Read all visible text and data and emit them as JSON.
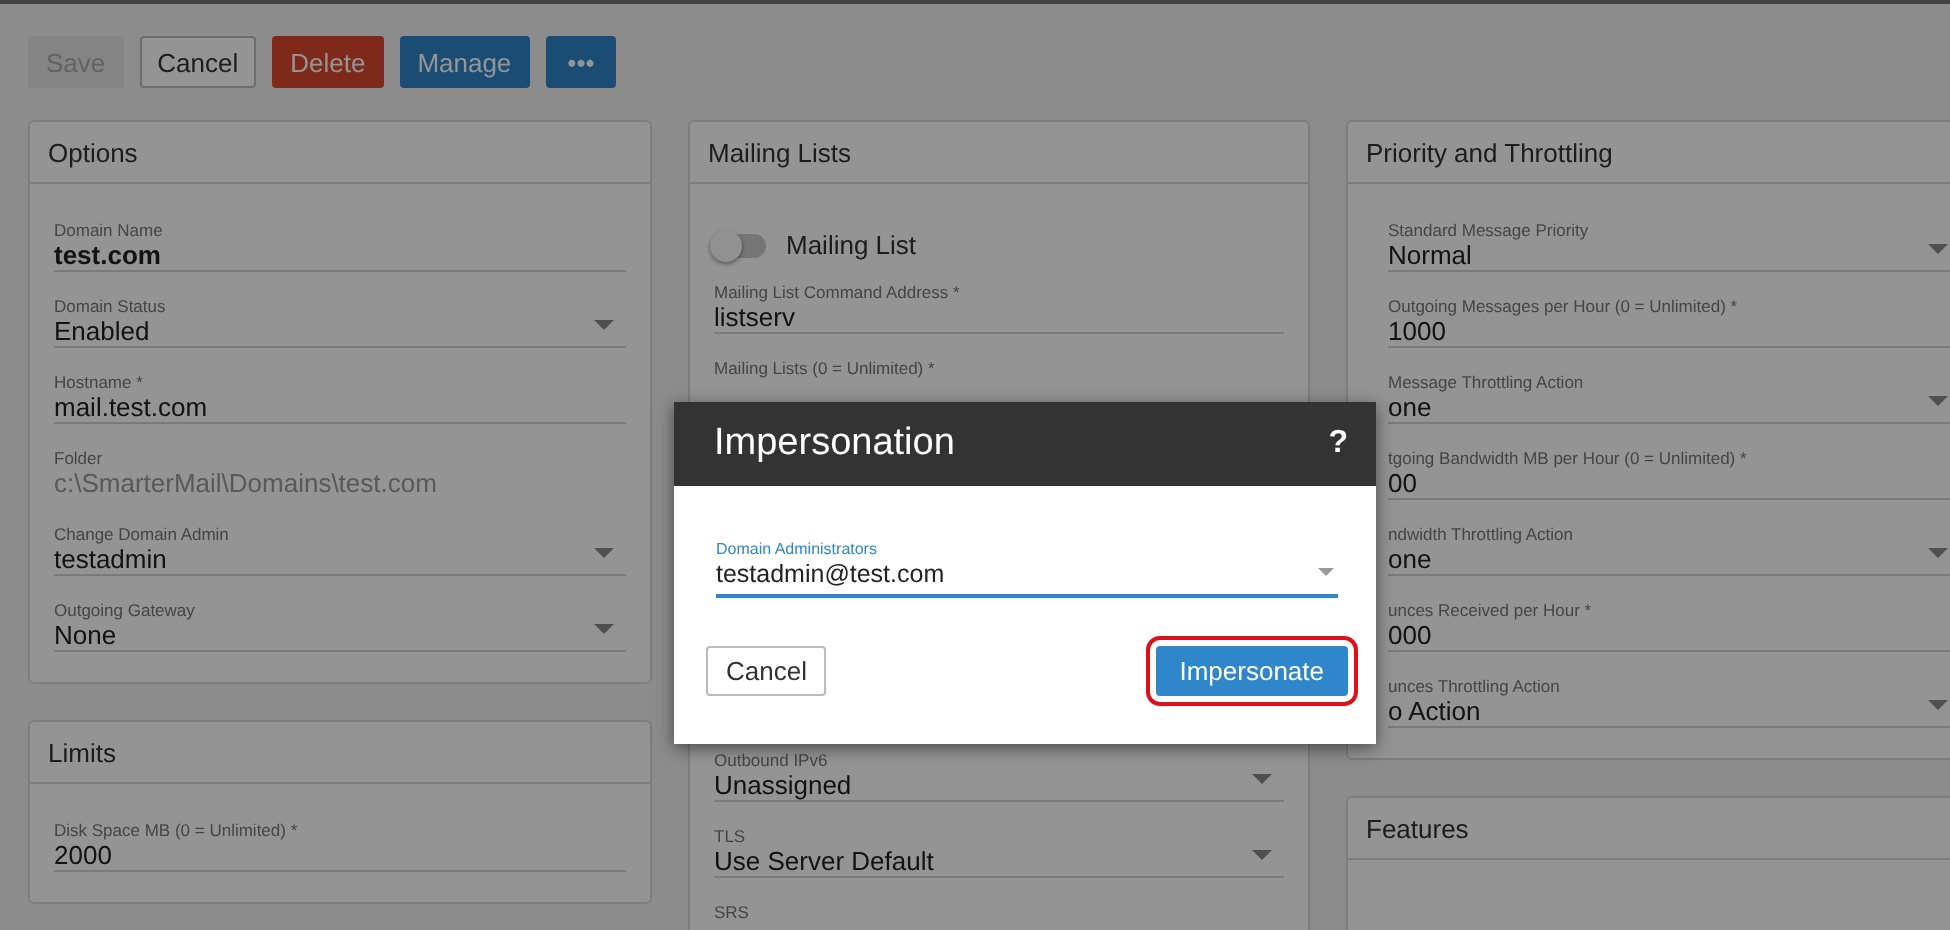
{
  "toolbar": {
    "buttons": [
      {
        "label": "Save",
        "kind": "plain",
        "disabled": true
      },
      {
        "label": "Cancel",
        "kind": "outline",
        "disabled": false
      },
      {
        "label": "Delete",
        "kind": "danger",
        "disabled": false
      },
      {
        "label": "Manage",
        "kind": "primary",
        "disabled": false
      },
      {
        "label": "•••",
        "kind": "primary",
        "disabled": false
      }
    ]
  },
  "columns": [
    {
      "cards": [
        {
          "title": "Options",
          "items": [
            {
              "kind": "text",
              "label": "Domain Name",
              "value": "test.com",
              "disabled": false,
              "bold": true
            },
            {
              "kind": "select",
              "label": "Domain Status",
              "value": "Enabled",
              "disabled": false
            },
            {
              "kind": "input",
              "label": "Hostname *",
              "value": "mail.test.com",
              "disabled": false
            },
            {
              "kind": "input",
              "label": "Folder",
              "value": "c:\\SmarterMail\\Domains\\test.com",
              "disabled": true
            },
            {
              "kind": "select",
              "label": "Change Domain Admin",
              "value": "testadmin",
              "disabled": false
            },
            {
              "kind": "select",
              "label": "Outgoing Gateway",
              "value": "None",
              "disabled": false
            }
          ]
        },
        {
          "title": "Limits",
          "items": [
            {
              "kind": "input",
              "label": "Disk Space MB (0 = Unlimited) *",
              "value": "2000",
              "disabled": false
            }
          ]
        }
      ]
    },
    {
      "cards": [
        {
          "title": "Mailing Lists",
          "items": [
            {
              "kind": "toggle",
              "label": "Mailing List",
              "on": false
            },
            {
              "kind": "input",
              "label": "Mailing List Command Address *",
              "value": "listserv",
              "disabled": false
            },
            {
              "kind": "input",
              "label": "Mailing Lists (0 = Unlimited) *"
            },
            {
              "kind": "select",
              "label": "Outbound IPv6",
              "value": "Unassigned",
              "disabled": false
            },
            {
              "kind": "select",
              "label": "TLS",
              "value": "Use Server Default",
              "disabled": false
            },
            {
              "kind": "input",
              "label": "SRS"
            }
          ]
        }
      ]
    },
    {
      "cards": [
        {
          "title": "Priority and Throttling",
          "items": [
            {
              "kind": "select",
              "label": "Standard Message Priority",
              "value": "Normal",
              "disabled": false
            },
            {
              "kind": "input",
              "label": "Outgoing Messages per Hour (0 = Unlimited) *",
              "value": "1000",
              "disabled": false
            },
            {
              "kind": "select",
              "label": "Message Throttling Action",
              "value": "one",
              "disabled": false
            },
            {
              "kind": "input",
              "label": "tgoing Bandwidth MB per Hour (0 = Unlimited) *",
              "value": "00",
              "disabled": false
            },
            {
              "kind": "select",
              "label": "ndwidth Throttling Action",
              "value": "one",
              "disabled": false
            },
            {
              "kind": "input",
              "label": "unces Received per Hour *",
              "value": "000",
              "disabled": false
            },
            {
              "kind": "select",
              "label": "unces Throttling Action",
              "value": "o Action",
              "disabled": false
            }
          ]
        },
        {
          "title": "Features"
        }
      ]
    }
  ],
  "dialog": {
    "title": "Impersonation",
    "help": "?",
    "field": {
      "label": "Domain Administrators",
      "value": "testadmin@test.com"
    },
    "buttons": [
      {
        "label": "Cancel",
        "kind": "outline",
        "highlighted": false
      },
      {
        "label": "Impersonate",
        "kind": "primary",
        "highlighted": true
      }
    ]
  }
}
